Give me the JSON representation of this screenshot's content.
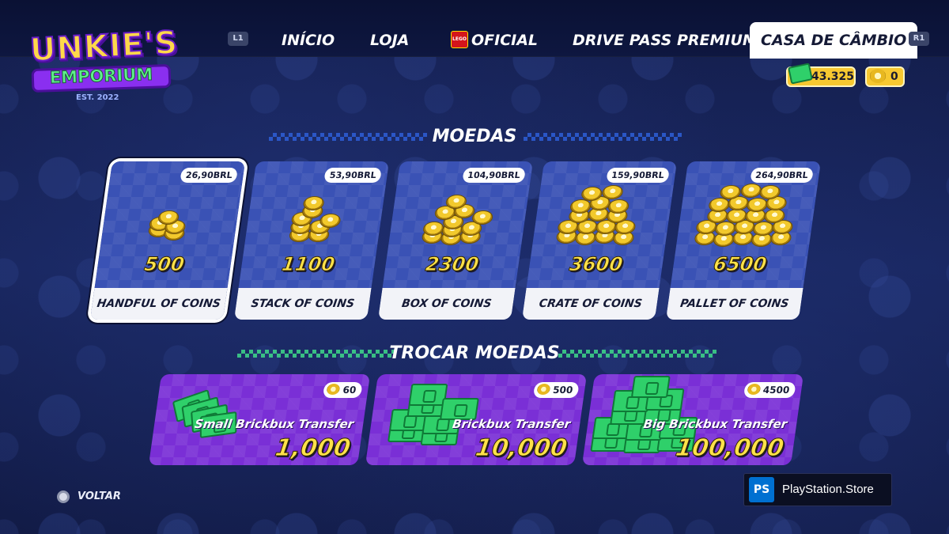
{
  "logo": {
    "line1": "UNKIE'S",
    "line2": "EMPORIUM",
    "est": "EST. 2022"
  },
  "nav": {
    "left_button": "L1",
    "right_button": "R1",
    "tabs": [
      {
        "label": "INÍCIO"
      },
      {
        "label": "LOJA"
      },
      {
        "label": "OFICIAL",
        "brand_badge": "LEGO"
      },
      {
        "label": "DRIVE PASS PREMIUM"
      },
      {
        "label": "CASA DE CÂMBIO",
        "active": true
      }
    ]
  },
  "currency": {
    "brickbux": "43.325",
    "coins": "0"
  },
  "coins_section": {
    "title": "MOEDAS",
    "items": [
      {
        "price": "26,90BRL",
        "amount": "500",
        "name": "HANDFUL OF COINS",
        "selected": true
      },
      {
        "price": "53,90BRL",
        "amount": "1100",
        "name": "STACK OF COINS"
      },
      {
        "price": "104,90BRL",
        "amount": "2300",
        "name": "BOX OF COINS"
      },
      {
        "price": "159,90BRL",
        "amount": "3600",
        "name": "CRATE OF COINS"
      },
      {
        "price": "264,90BRL",
        "amount": "6500",
        "name": "PALLET OF COINS"
      }
    ]
  },
  "exchange_section": {
    "title": "TROCAR MOEDAS",
    "items": [
      {
        "cost": "60",
        "name": "Small Brickbux Transfer",
        "amount": "1,000"
      },
      {
        "cost": "500",
        "name": "Brickbux Transfer",
        "amount": "10,000"
      },
      {
        "cost": "4500",
        "name": "Big Brickbux Transfer",
        "amount": "100,000"
      }
    ]
  },
  "footer": {
    "back_label": "VOLTAR",
    "store_label": "PlayStation.Store"
  },
  "colors": {
    "accent_yellow": "#ffe24a",
    "exchange_purple": "#7a2fd6",
    "card_blue": "#3a52b5",
    "bux_green": "#2fd06a"
  }
}
